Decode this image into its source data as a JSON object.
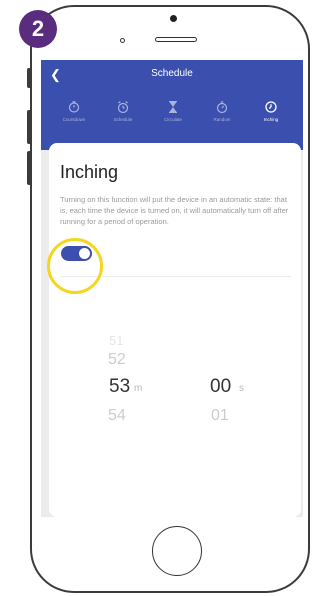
{
  "step_badge": "2",
  "app": {
    "title": "Schedule",
    "back_icon": "back-arrow-icon",
    "tabs": [
      {
        "label": "Countdown",
        "icon": "timer-icon",
        "active": false
      },
      {
        "label": "Schedule",
        "icon": "alarm-clock-icon",
        "active": false
      },
      {
        "label": "Circulate",
        "icon": "hourglass-icon",
        "active": false
      },
      {
        "label": "Random",
        "icon": "stopwatch-icon",
        "active": false
      },
      {
        "label": "Inching",
        "icon": "clock-icon",
        "active": true
      }
    ]
  },
  "inching": {
    "title": "Inching",
    "description": "Turning on this function will put the device in an automatic state: that is, each time the device is turned on, it will automatically turn off after running for a period of operation.",
    "toggle_on": true,
    "picker": {
      "minutes": {
        "above2": "51",
        "above": "52",
        "selected": "53",
        "below": "54",
        "unit": "m"
      },
      "seconds": {
        "selected": "00",
        "below": "01",
        "unit": "s"
      }
    }
  },
  "colors": {
    "accent": "#3a4fae",
    "highlight": "#f5d51e",
    "badge": "#5a2c7e"
  }
}
